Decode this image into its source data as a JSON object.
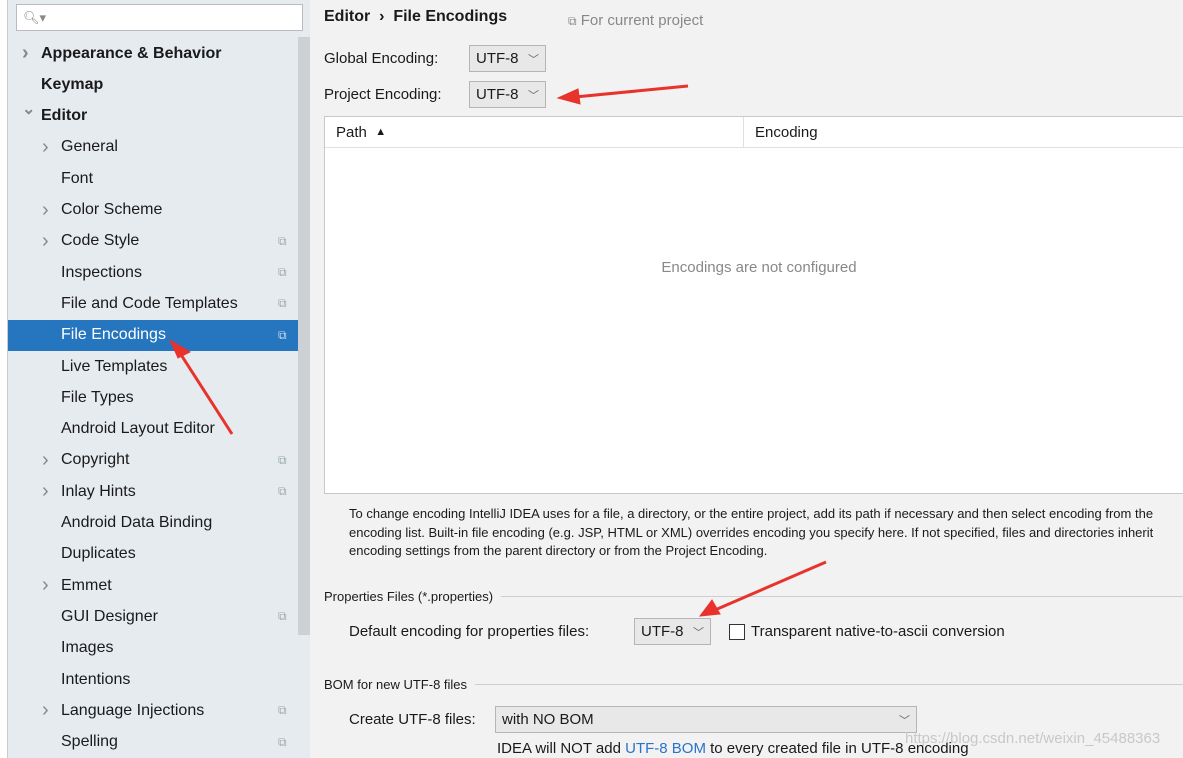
{
  "sidebar": {
    "search_placeholder": "",
    "items": [
      {
        "label": "Appearance & Behavior",
        "level": 0,
        "expand": "collapsed"
      },
      {
        "label": "Keymap",
        "level": 0,
        "expand": "none"
      },
      {
        "label": "Editor",
        "level": 0,
        "expand": "expanded"
      },
      {
        "label": "General",
        "level": 1,
        "expand": "collapsed"
      },
      {
        "label": "Font",
        "level": 1,
        "expand": "none"
      },
      {
        "label": "Color Scheme",
        "level": 1,
        "expand": "collapsed"
      },
      {
        "label": "Code Style",
        "level": 1,
        "expand": "collapsed",
        "project": true
      },
      {
        "label": "Inspections",
        "level": 1,
        "expand": "none",
        "project": true
      },
      {
        "label": "File and Code Templates",
        "level": 1,
        "expand": "none",
        "project": true
      },
      {
        "label": "File Encodings",
        "level": 1,
        "expand": "none",
        "project": true,
        "selected": true
      },
      {
        "label": "Live Templates",
        "level": 1,
        "expand": "none"
      },
      {
        "label": "File Types",
        "level": 1,
        "expand": "none"
      },
      {
        "label": "Android Layout Editor",
        "level": 1,
        "expand": "none"
      },
      {
        "label": "Copyright",
        "level": 1,
        "expand": "collapsed",
        "project": true
      },
      {
        "label": "Inlay Hints",
        "level": 1,
        "expand": "collapsed",
        "project": true
      },
      {
        "label": "Android Data Binding",
        "level": 1,
        "expand": "none"
      },
      {
        "label": "Duplicates",
        "level": 1,
        "expand": "none"
      },
      {
        "label": "Emmet",
        "level": 1,
        "expand": "collapsed"
      },
      {
        "label": "GUI Designer",
        "level": 1,
        "expand": "none",
        "project": true
      },
      {
        "label": "Images",
        "level": 1,
        "expand": "none"
      },
      {
        "label": "Intentions",
        "level": 1,
        "expand": "none"
      },
      {
        "label": "Language Injections",
        "level": 1,
        "expand": "collapsed",
        "project": true
      },
      {
        "label": "Spelling",
        "level": 1,
        "expand": "none",
        "project": true
      }
    ]
  },
  "header": {
    "crumb_parent": "Editor",
    "crumb_sep": "›",
    "crumb_current": "File Encodings",
    "for_project": "For current project"
  },
  "global": {
    "label": "Global Encoding:",
    "value": "UTF-8"
  },
  "project": {
    "label": "Project Encoding:",
    "value": "UTF-8"
  },
  "table": {
    "col_path": "Path",
    "sort": "▲",
    "col_encoding": "Encoding",
    "empty": "Encodings are not configured"
  },
  "help": [
    "To change encoding IntelliJ IDEA uses for a file, a directory, or the entire project, add its path if necessary and then select encoding from the",
    "encoding list. Built-in file encoding (e.g. JSP, HTML or XML) overrides encoding you specify here. If not specified, files and directories inherit",
    "encoding settings from the parent directory or from the Project Encoding."
  ],
  "properties": {
    "section": "Properties Files (*.properties)",
    "label": "Default encoding for properties files:",
    "value": "UTF-8",
    "checkbox_label": "Transparent native-to-ascii conversion",
    "checked": false
  },
  "bom": {
    "section": "BOM for new UTF-8 files",
    "label": "Create UTF-8 files:",
    "value": "with NO BOM",
    "note_pre": "IDEA will NOT add ",
    "note_link": "UTF-8 BOM",
    "note_post": " to every created file in UTF-8 encoding"
  },
  "watermark": "https://blog.csdn.net/weixin_45488363",
  "colors": {
    "selection": "#2675bf",
    "annotation_arrow": "#e8332d",
    "link": "#2a73c9"
  }
}
